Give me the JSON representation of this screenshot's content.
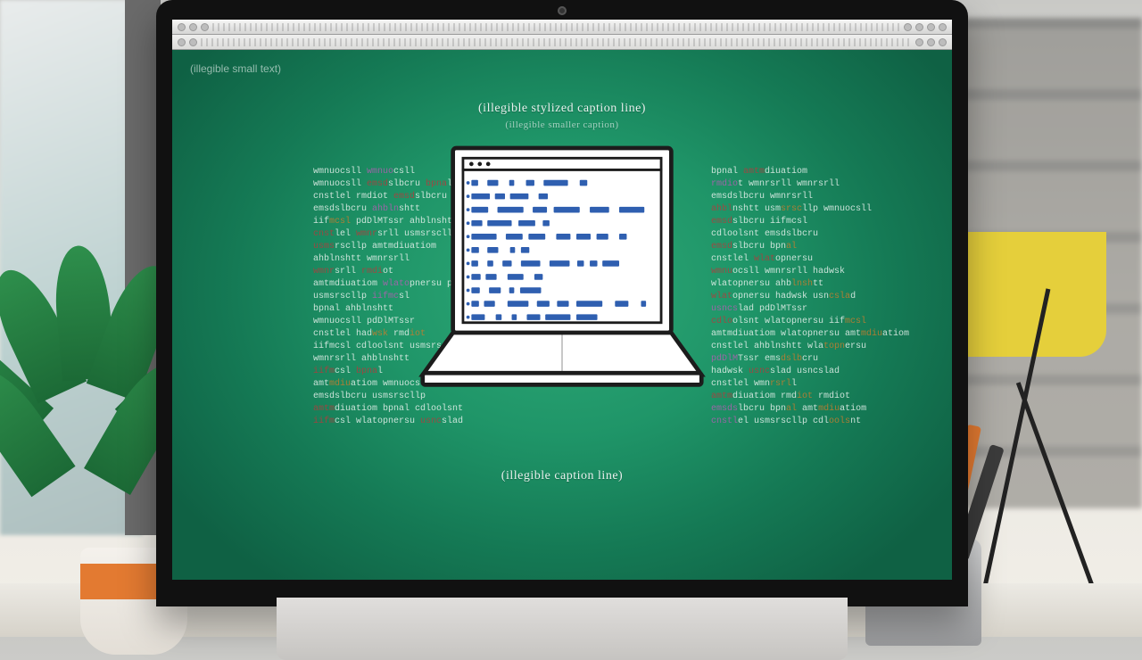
{
  "note": "The source is a photo/illustration of a computer monitor on a desk. Almost all on-screen text is AI-generated gibberish / unreadable.",
  "monitor": {
    "style": "black-bezel-allinone",
    "has_camera": true
  },
  "screen": {
    "chrome_rows": 2,
    "chrome_note": "two light-gray toolbar strips with small icons + illegible glyph sequences",
    "slide": {
      "background_color": "#1f9568",
      "breadcrumb": "(illegible small text)",
      "top_caption": "(illegible stylized caption line)",
      "sub_caption": "(illegible smaller caption)",
      "bottom_caption": "(illegible caption line)",
      "laptop_figure": {
        "shape": "line-art laptop, white screen, titlebar dots",
        "screen_content": "rows of short blue bar-glyphs",
        "rows": 11
      },
      "left_code": {
        "lines": 21,
        "note": "columns of mixed white/red/orange/purple monospaced gibberish"
      },
      "right_code": {
        "lines": 21,
        "note": "similar gibberish column, slightly wider"
      }
    }
  },
  "foreground": {
    "left_cup": "paper coffee cup, orange band",
    "right_pen_holder": "metal cup with several pens",
    "right_lamp": "yellow desk lamp",
    "left_plant": "green leafy plant",
    "background": "blurred office shelves / windows"
  }
}
